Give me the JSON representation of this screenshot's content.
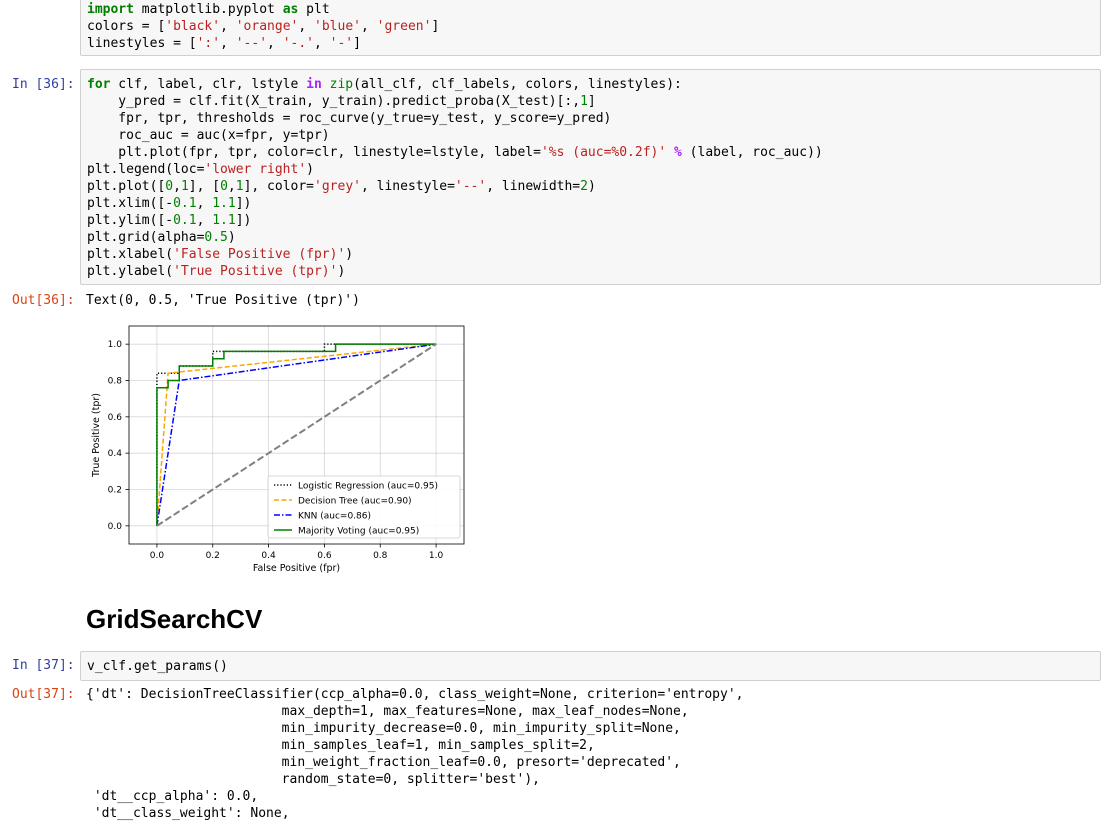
{
  "cells": {
    "top_input": {
      "lines": [
        "import matplotlib.pyplot as plt",
        "colors = ['black', 'orange', 'blue', 'green']",
        "linestyles = [':', '--', '-.', '-']"
      ]
    },
    "cell36": {
      "in_prompt": "In [36]:",
      "out_prompt": "Out[36]:",
      "code": [
        "for clf, label, clr, lstyle in zip(all_clf, clf_labels, colors, linestyles):",
        "    y_pred = clf.fit(X_train, y_train).predict_proba(X_test)[:,1]",
        "    fpr, tpr, thresholds = roc_curve(y_true=y_test, y_score=y_pred)",
        "    roc_auc = auc(x=fpr, y=tpr)",
        "    plt.plot(fpr, tpr, color=clr, linestyle=lstyle, label='%s (auc=%0.2f)' % (label, roc_auc))",
        "plt.legend(loc='lower right')",
        "plt.plot([0,1], [0,1], color='grey', linestyle='--', linewidth=2)",
        "plt.xlim([-0.1, 1.1])",
        "plt.ylim([-0.1, 1.1])",
        "plt.grid(alpha=0.5)",
        "plt.xlabel('False Positive (fpr)')",
        "plt.ylabel('True Positive (tpr)')"
      ],
      "output": "Text(0, 0.5, 'True Positive (tpr)')"
    },
    "heading": "GridSearchCV",
    "cell37": {
      "in_prompt": "In [37]:",
      "out_prompt": "Out[37]:",
      "code": "v_clf.get_params()",
      "output": [
        "{'dt': DecisionTreeClassifier(ccp_alpha=0.0, class_weight=None, criterion='entropy',",
        "                         max_depth=1, max_features=None, max_leaf_nodes=None,",
        "                         min_impurity_decrease=0.0, min_impurity_split=None,",
        "                         min_samples_leaf=1, min_samples_split=2,",
        "                         min_weight_fraction_leaf=0.0, presort='deprecated',",
        "                         random_state=0, splitter='best'),",
        " 'dt__ccp_alpha': 0.0,",
        " 'dt__class_weight': None,"
      ]
    }
  },
  "chart_data": {
    "type": "line",
    "xlabel": "False Positive (fpr)",
    "ylabel": "True Positive (tpr)",
    "xlim": [
      -0.1,
      1.1
    ],
    "ylim": [
      -0.1,
      1.1
    ],
    "xticks": [
      "0.0",
      "0.2",
      "0.4",
      "0.6",
      "0.8",
      "1.0"
    ],
    "yticks": [
      "0.0",
      "0.2",
      "0.4",
      "0.6",
      "0.8",
      "1.0"
    ],
    "grid": true,
    "legend_loc": "lower right",
    "series": [
      {
        "name": "Logistic Regression (auc=0.95)",
        "color": "#000000",
        "dash": "dotted",
        "x": [
          0,
          0,
          0.08,
          0.08,
          0.2,
          0.2,
          0.6,
          0.6,
          1.0
        ],
        "y": [
          0,
          0.84,
          0.84,
          0.88,
          0.88,
          0.96,
          0.96,
          1.0,
          1.0
        ]
      },
      {
        "name": "Decision Tree (auc=0.90)",
        "color": "#ffa500",
        "dash": "dashed",
        "x": [
          0,
          0.04,
          1.0
        ],
        "y": [
          0,
          0.84,
          1.0
        ]
      },
      {
        "name": "KNN (auc=0.86)",
        "color": "#0000ff",
        "dash": "dashdot",
        "x": [
          0,
          0.08,
          1.0
        ],
        "y": [
          0,
          0.8,
          1.0
        ]
      },
      {
        "name": "Majority Voting (auc=0.95)",
        "color": "#008000",
        "dash": "solid",
        "x": [
          0,
          0,
          0.04,
          0.04,
          0.08,
          0.08,
          0.2,
          0.2,
          0.24,
          0.24,
          0.64,
          0.64,
          1.0
        ],
        "y": [
          0,
          0.76,
          0.76,
          0.8,
          0.8,
          0.88,
          0.88,
          0.92,
          0.92,
          0.96,
          0.96,
          1.0,
          1.0
        ]
      }
    ],
    "reference_line": {
      "x": [
        0,
        1
      ],
      "y": [
        0,
        1
      ],
      "color": "#808080",
      "dash": "dashed"
    }
  }
}
